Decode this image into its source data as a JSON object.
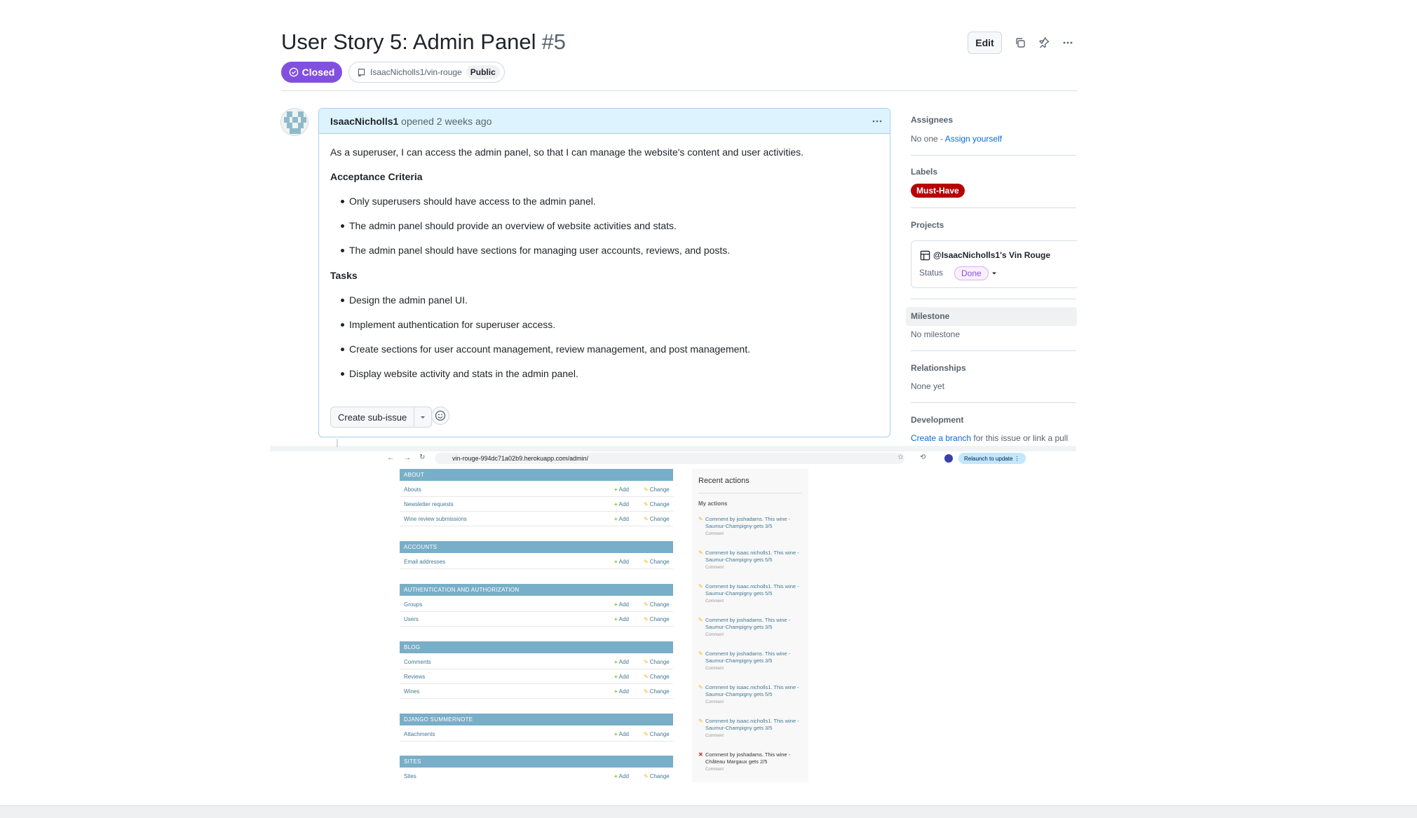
{
  "issue": {
    "title": "User Story 5: Admin Panel",
    "number": "#5",
    "edit_label": "Edit",
    "state": "Closed",
    "repo": "IsaacNicholls1/vin-rouge",
    "visibility": "Public"
  },
  "comment": {
    "author": "IsaacNicholls1",
    "meta": "opened 2 weeks ago",
    "intro": "As a superuser, I can access the admin panel, so that I can manage the website's content and user activities.",
    "criteria_heading": "Acceptance Criteria",
    "criteria": [
      "Only superusers should have access to the admin panel.",
      "The admin panel should provide an overview of website activities and stats.",
      "The admin panel should have sections for managing user accounts, reviews, and posts."
    ],
    "tasks_heading": "Tasks",
    "tasks": [
      "Design the admin panel UI.",
      "Implement authentication for superuser access.",
      "Create sections for user account management, review management, and post management.",
      "Display website activity and stats in the admin panel."
    ],
    "sub_issue_label": "Create sub-issue"
  },
  "sidebar": {
    "assignees_heading": "Assignees",
    "assignees_value": "No one -",
    "assign_link": "Assign yourself",
    "labels_heading": "Labels",
    "label": "Must-Have",
    "label_color": "#b60205",
    "projects_heading": "Projects",
    "project_name": "@IsaacNicholls1's Vin Rouge",
    "status_label": "Status",
    "status_value": "Done",
    "milestone_heading": "Milestone",
    "milestone_value": "No milestone",
    "relationships_heading": "Relationships",
    "relationships_value": "None yet",
    "development_heading": "Development",
    "dev_link": "Create a branch",
    "dev_text": "for this issue or link a pull"
  },
  "screenshot": {
    "url": "vin-rouge-994dc71a02b9.herokuapp.com/admin/",
    "relaunch": "Relaunch to update",
    "add_label": "Add",
    "change_label": "Change",
    "modules": [
      {
        "name": "ABOUT",
        "rows": [
          "Abouts",
          "Newsletter requests",
          "Wine review submissions"
        ]
      },
      {
        "name": "ACCOUNTS",
        "rows": [
          "Email addresses"
        ]
      },
      {
        "name": "AUTHENTICATION AND AUTHORIZATION",
        "rows": [
          "Groups",
          "Users"
        ]
      },
      {
        "name": "BLOG",
        "rows": [
          "Comments",
          "Reviews",
          "Wines"
        ]
      },
      {
        "name": "DJANGO SUMMERNOTE",
        "rows": [
          "Attachments"
        ]
      },
      {
        "name": "SITES",
        "rows": [
          "Sites"
        ]
      }
    ],
    "recent_title": "Recent actions",
    "my_actions": "My actions",
    "actions": [
      {
        "text": "Comment by joshadams. This wine - Saumur-Champigny gets 3/5",
        "type": "Comment",
        "kind": "change"
      },
      {
        "text": "Comment by isaac.nicholls1. This wine - Saumur-Champigny gets 5/5",
        "type": "Comment",
        "kind": "change"
      },
      {
        "text": "Comment by isaac.nicholls1. This wine - Saumur-Champigny gets 5/5",
        "type": "Comment",
        "kind": "change"
      },
      {
        "text": "Comment by joshadams. This wine - Saumur-Champigny gets 3/5",
        "type": "Comment",
        "kind": "change"
      },
      {
        "text": "Comment by joshadams. This wine - Saumur-Champigny gets 3/5",
        "type": "Comment",
        "kind": "change"
      },
      {
        "text": "Comment by isaac.nicholls1. This wine - Saumur-Champigny gets 5/5",
        "type": "Comment",
        "kind": "change"
      },
      {
        "text": "Comment by isaac.nicholls1. This wine - Saumur-Champigny gets 3/5",
        "type": "Comment",
        "kind": "change"
      },
      {
        "text": "Comment by joshadams. This wine - Château Margaux gets 2/5",
        "type": "Comment",
        "kind": "delete"
      }
    ]
  }
}
